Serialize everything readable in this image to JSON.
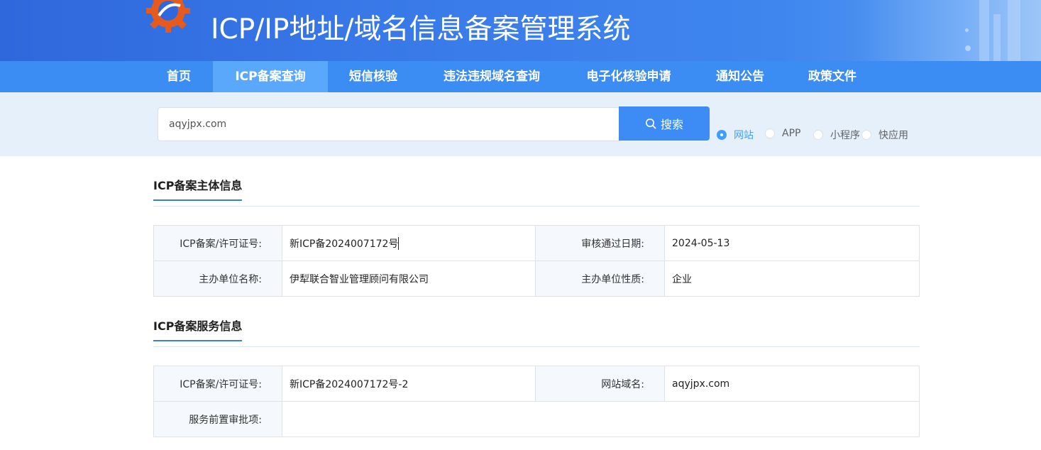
{
  "header": {
    "title": "ICP/IP地址/域名信息备案管理系统",
    "logo_icon": "gear-logo-icon"
  },
  "nav": {
    "items": [
      {
        "label": "首页",
        "active": false
      },
      {
        "label": "ICP备案查询",
        "active": true
      },
      {
        "label": "短信核验",
        "active": false
      },
      {
        "label": "违法违规域名查询",
        "active": false
      },
      {
        "label": "电子化核验申请",
        "active": false
      },
      {
        "label": "通知公告",
        "active": false
      },
      {
        "label": "政策文件",
        "active": false
      }
    ]
  },
  "search": {
    "value": "aqyjpx.com",
    "button_label": "搜索",
    "button_icon": "search-icon",
    "options": [
      {
        "label": "网站",
        "checked": true
      },
      {
        "label": "APP",
        "checked": false
      },
      {
        "label": "小程序",
        "checked": false
      },
      {
        "label": "快应用",
        "checked": false
      }
    ]
  },
  "subject_info": {
    "title": "ICP备案主体信息",
    "rows": [
      {
        "label1": "ICP备案/许可证号:",
        "value1": "新ICP备2024007172号",
        "label2": "审核通过日期:",
        "value2": "2024-05-13"
      },
      {
        "label1": "主办单位名称:",
        "value1": "伊犁联合智业管理顾问有限公司",
        "label2": "主办单位性质:",
        "value2": "企业"
      }
    ]
  },
  "service_info": {
    "title": "ICP备案服务信息",
    "row1": {
      "label1": "ICP备案/许可证号:",
      "value1": "新ICP备2024007172号-2",
      "label2": "网站域名:",
      "value2": "aqyjpx.com"
    },
    "row2": {
      "label": "服务前置审批项:",
      "value": ""
    }
  },
  "colors": {
    "header": "#3a7cea",
    "nav": "#3b8cf3",
    "nav_active": "#5aa8fb",
    "search_button": "#3d8bf5",
    "search_band": "#e6f0fa",
    "accent": "#409eff"
  }
}
